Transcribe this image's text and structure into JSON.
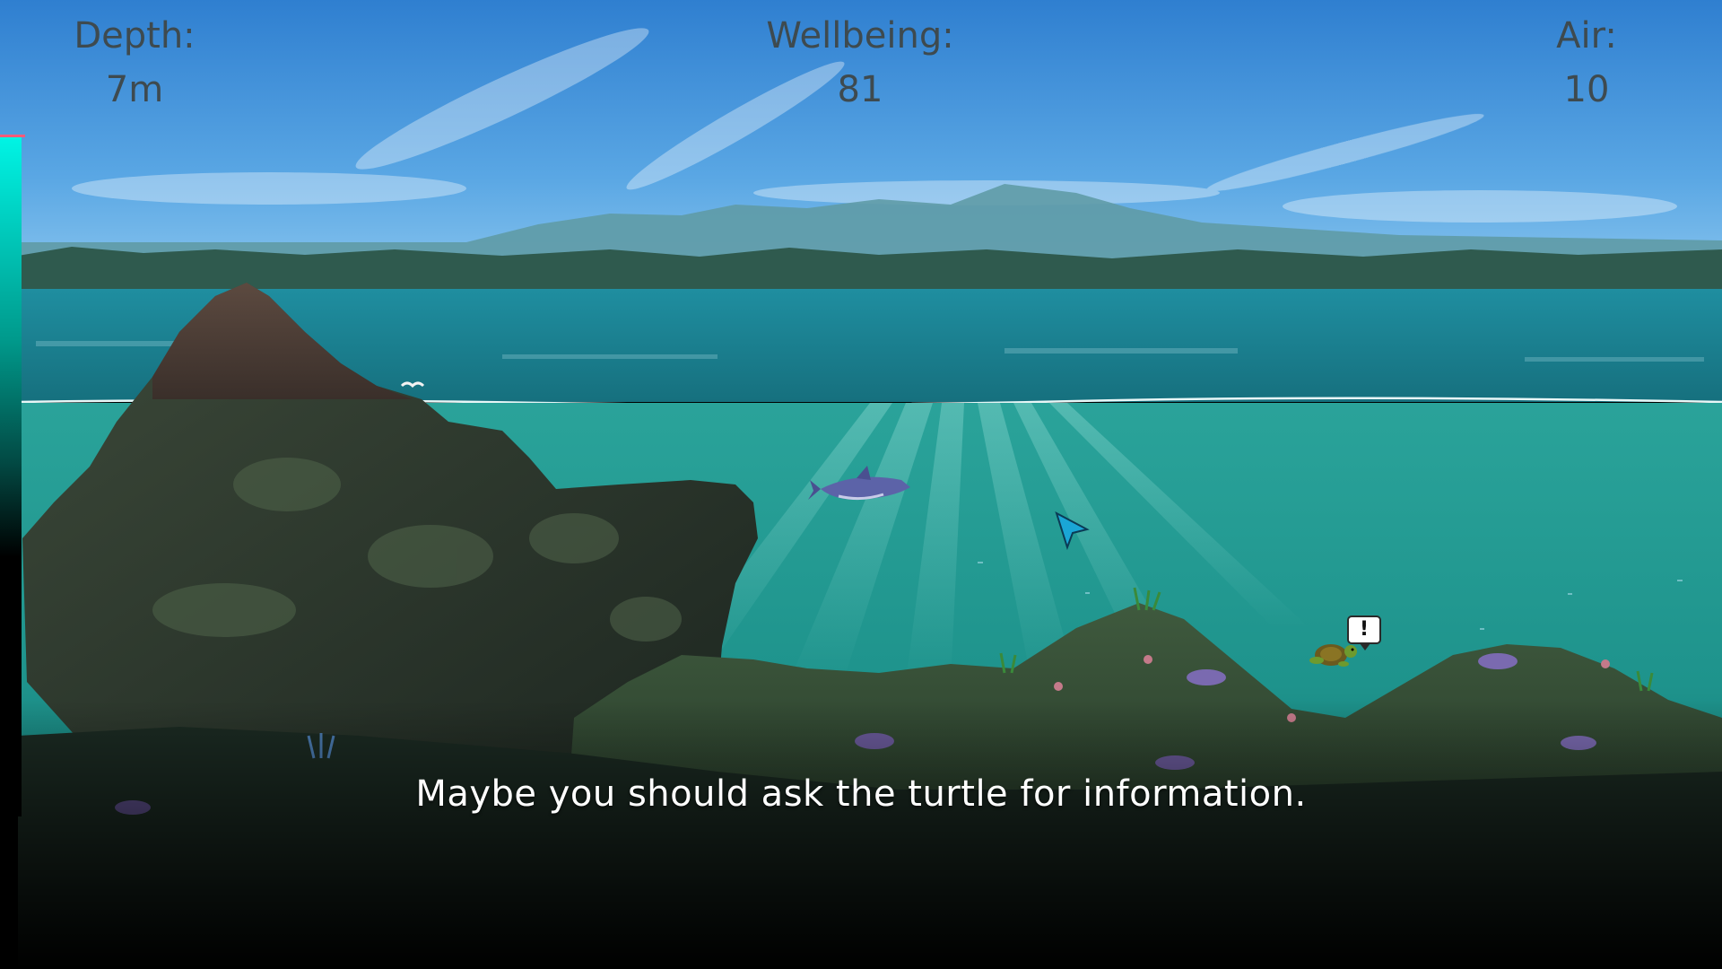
{
  "hud": {
    "depth": {
      "label": "Depth:",
      "value": "7m"
    },
    "wellbeing": {
      "label": "Wellbeing:",
      "value": "81"
    },
    "air": {
      "label": "Air:",
      "value": "10"
    }
  },
  "dialogue": {
    "text": "Maybe you should ask the turtle for information."
  },
  "speech_bubble_glyph": "!",
  "icons": {
    "cursor": "arrow-cursor-icon",
    "alert": "exclamation-bubble-icon"
  },
  "colors": {
    "sky_top": "#2f7fd0",
    "sea_surface": "#1c8c98",
    "underwater": "#2fa29a",
    "gauge_top": "#00f5e6",
    "hud_text": "#3e4a4f"
  }
}
